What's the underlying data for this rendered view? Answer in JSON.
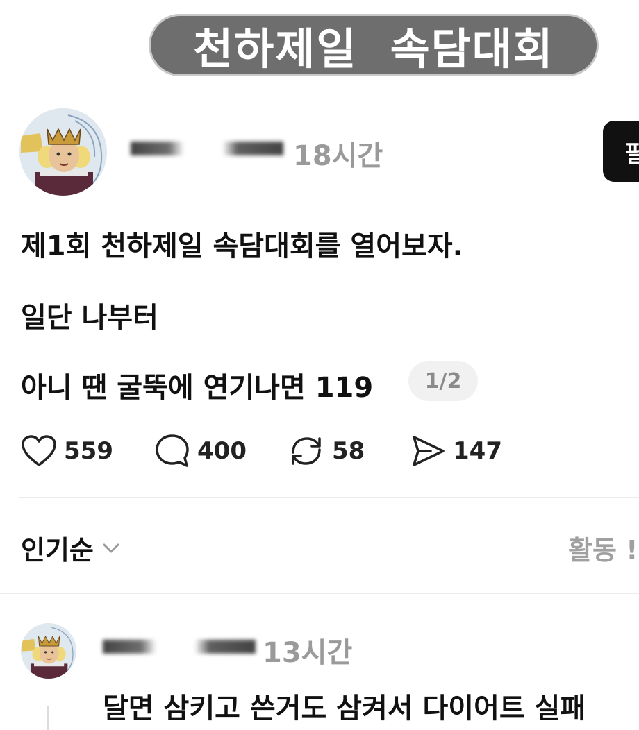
{
  "banner": {
    "title": "천하제일  속담대회"
  },
  "post": {
    "time": "18시간",
    "follow_label": "팔",
    "lines": [
      "제1회 천하제일 속담대회를 열어보자.",
      "일단 나부터",
      "아니 땐 굴뚝에 연기나면 119"
    ],
    "page_indicator": "1/2",
    "actions": {
      "likes": "559",
      "comments": "400",
      "reposts": "58",
      "shares": "147"
    }
  },
  "sort": {
    "label": "인기순",
    "activity_label": "활동 !"
  },
  "comment": {
    "time": "13시간",
    "text": "달면 삼키고 쓴거도 삼켜서 다이어트 실패"
  },
  "icons": {
    "avatar": "king-avatar-icon",
    "like": "heart-icon",
    "comment": "speech-bubble-icon",
    "repost": "repost-arrows-icon",
    "share": "send-icon",
    "dropdown": "chevron-down-icon"
  },
  "colors": {
    "banner_bg": "#6e6e6e",
    "muted_text": "#9a9a9a",
    "follow_bg": "#111111"
  }
}
